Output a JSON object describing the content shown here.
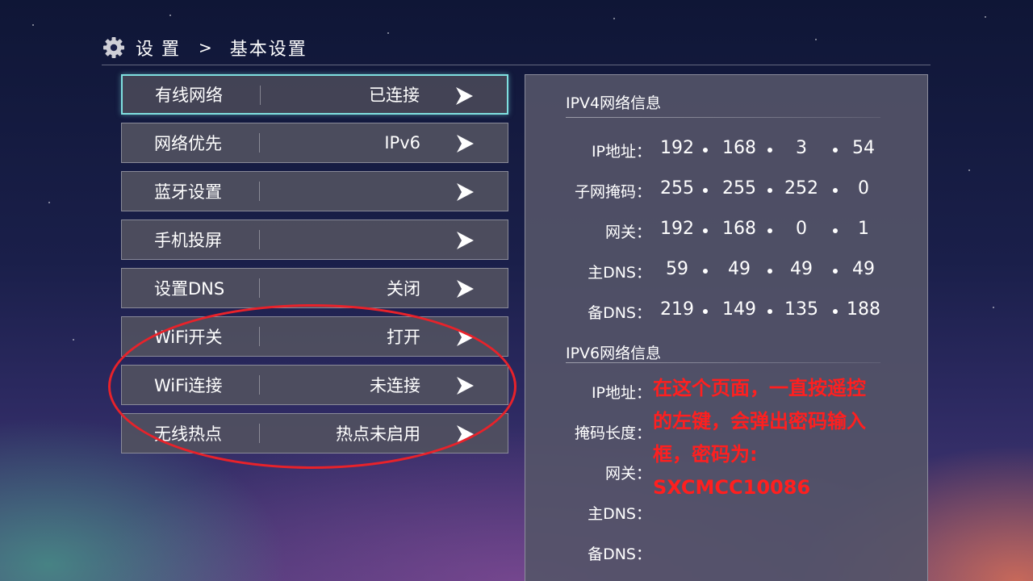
{
  "header": {
    "breadcrumb_root": "设置",
    "breadcrumb_sep": ">",
    "breadcrumb_current": "基本设置",
    "icon": "gear-icon"
  },
  "menu": [
    {
      "label": "有线网络",
      "value": "已连接",
      "focused": true
    },
    {
      "label": "网络优先",
      "value": "IPv6"
    },
    {
      "label": "蓝牙设置",
      "value": ""
    },
    {
      "label": "手机投屏",
      "value": ""
    },
    {
      "label": "设置DNS",
      "value": "关闭"
    },
    {
      "label": "WiFi开关",
      "value": "打开"
    },
    {
      "label": "WiFi连接",
      "value": "未连接"
    },
    {
      "label": "无线热点",
      "value": "热点未启用"
    }
  ],
  "ipv4": {
    "title": "IPV4网络信息",
    "rows": [
      {
        "label": "IP地址：",
        "octets": [
          "192",
          "168",
          "3",
          "54"
        ]
      },
      {
        "label": "子网掩码：",
        "octets": [
          "255",
          "255",
          "252",
          "0"
        ]
      },
      {
        "label": "网关：",
        "octets": [
          "192",
          "168",
          "0",
          "1"
        ]
      },
      {
        "label": "主DNS：",
        "octets": [
          "59",
          "49",
          "49",
          "49"
        ]
      },
      {
        "label": "备DNS：",
        "octets": [
          "219",
          "149",
          "135",
          "188"
        ]
      }
    ]
  },
  "ipv6": {
    "title": "IPV6网络信息",
    "rows": [
      {
        "label": "IP地址："
      },
      {
        "label": "掩码长度："
      },
      {
        "label": "网关："
      },
      {
        "label": "主DNS："
      },
      {
        "label": "备DNS："
      }
    ]
  },
  "annotation": {
    "line1": "在这个页面，一直按遥控",
    "line2": "的左键，会弹出密码输入",
    "line3": "框，密码为:",
    "line4": "SXCMCC10086",
    "color": "#ff1f1f"
  },
  "colors": {
    "focus_border": "#7fe0e0",
    "highlight_ellipse": "#e8222a"
  }
}
